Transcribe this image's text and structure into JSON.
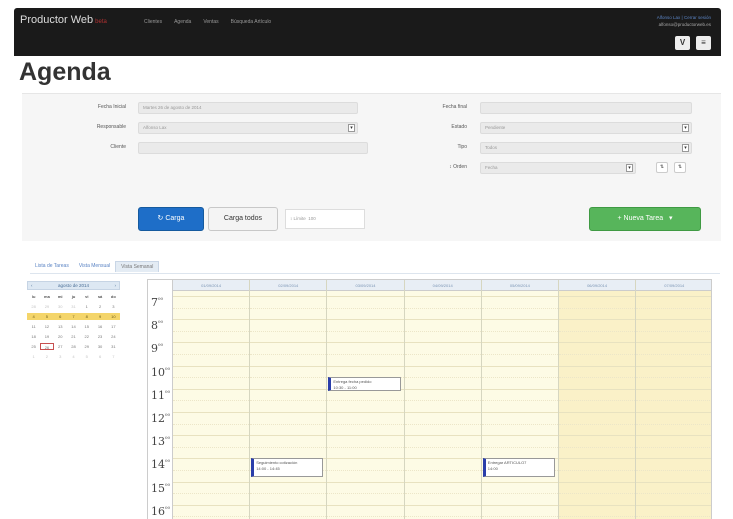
{
  "brand": {
    "name": "Productor Web",
    "suffix": "beta"
  },
  "nav": [
    "Clientes",
    "Agenda",
    "Ventas",
    "Búsqueda Artículo"
  ],
  "user": {
    "line1": "Alfonso Lax | Cerrar sesión",
    "line2": "alfonso@productorweb.es"
  },
  "nav_buttons": [
    "V",
    "≡"
  ],
  "page_title": "Agenda",
  "form": {
    "fecha_inicial": {
      "label": "Fecha Inicial",
      "value": "Martes 26 de agosto de 2014"
    },
    "responsable": {
      "label": "Responsable",
      "value": "Alfonso Lax"
    },
    "cliente": {
      "label": "Cliente",
      "value": ""
    },
    "fecha_final": {
      "label": "Fecha final",
      "value": ""
    },
    "estado": {
      "label": "Estado",
      "value": "Pendiente"
    },
    "tipo": {
      "label": "Tipo",
      "value": "Todos"
    },
    "orden": {
      "label": "↕ Orden",
      "value": "Fecha"
    }
  },
  "buttons": {
    "cargar": "↻ Carga",
    "cargar_todos": "Carga todos",
    "nueva_tarea": "+ Nueva Tarea",
    "nueva_tarea_caret": "▾"
  },
  "limit": {
    "label": "↕ Límite",
    "value": "100"
  },
  "tabs": [
    "Lista de Tareas",
    "Vista Mensual",
    "Vista Semanal"
  ],
  "minical": {
    "title": "agosto de 2014",
    "prev": "‹",
    "next": "›",
    "weekdays": [
      "lu",
      "ma",
      "mi",
      "ju",
      "vi",
      "sá",
      "do"
    ],
    "days": [
      [
        "28",
        "29",
        "30",
        "31",
        "1",
        "2",
        "3"
      ],
      [
        "4",
        "5",
        "6",
        "7",
        "8",
        "9",
        "10"
      ],
      [
        "11",
        "12",
        "13",
        "14",
        "15",
        "16",
        "17"
      ],
      [
        "18",
        "19",
        "20",
        "21",
        "22",
        "23",
        "24"
      ],
      [
        "25",
        "26",
        "27",
        "28",
        "29",
        "30",
        "31"
      ],
      [
        "1",
        "2",
        "3",
        "4",
        "5",
        "6",
        "7"
      ]
    ],
    "highlight_row": 1,
    "today": "26"
  },
  "week": {
    "days": [
      "01/09/2014",
      "02/09/2014",
      "03/09/2014",
      "04/09/2014",
      "05/09/2014",
      "06/09/2014",
      "07/09/2014"
    ],
    "hours": [
      "7",
      "8",
      "9",
      "10",
      "11",
      "12",
      "13",
      "14",
      "15",
      "16"
    ],
    "events": [
      {
        "day": 2,
        "start": 10.5,
        "end": 11.0,
        "title": "Entrega fecha pedido",
        "time": "10:30 - 11:00"
      },
      {
        "day": 1,
        "start": 14.0,
        "end": 14.7,
        "title": "Seguimiento cotización",
        "time": "14:00 - 14:45"
      },
      {
        "day": 4,
        "start": 14.0,
        "end": 14.7,
        "title": "Entregar ARTICULO7",
        "time": "14:00"
      }
    ]
  }
}
